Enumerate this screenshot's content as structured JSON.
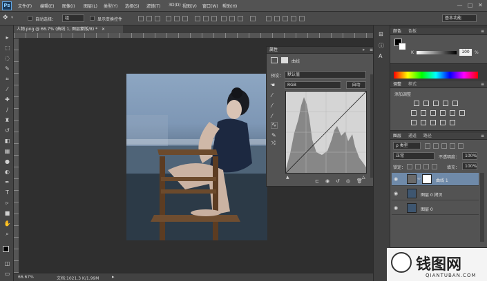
{
  "app": {
    "logo": "Ps",
    "menus": [
      "文件(F)",
      "编辑(E)",
      "图像(I)",
      "图层(L)",
      "类型(Y)",
      "选择(S)",
      "滤镜(T)",
      "3D(D)",
      "视图(V)",
      "窗口(W)",
      "帮助(H)"
    ],
    "window_controls": [
      "—",
      "□",
      "✕"
    ]
  },
  "options_bar": {
    "auto_select_label": "自动选择：",
    "auto_select_value": "组",
    "transform_label": "显示变换控件",
    "workspace": "基本功能"
  },
  "document": {
    "tab_title": "人物.png @ 66.7% (曲线 1, 图层蒙版/8) *",
    "tab_close": "✕",
    "zoom": "66.67%",
    "doc_info": "文档:1021.3 K/1.99M"
  },
  "properties": {
    "title": "属性",
    "adjustment_name": "曲线",
    "preset_label": "预设：",
    "preset_value": "默认值",
    "channel_value": "RGB",
    "auto_button": "自动"
  },
  "color_panel": {
    "tabs": [
      "颜色",
      "色板"
    ],
    "k_label": "K",
    "k_value": "100",
    "k_unit": "%"
  },
  "adjustments_panel": {
    "tabs": [
      "调整",
      "样式"
    ],
    "subtitle": "添加调整"
  },
  "layers_panel": {
    "tabs": [
      "图层",
      "通道",
      "路径"
    ],
    "filter_label": "ρ 类型",
    "blend_mode": "正常",
    "opacity_label": "不透明度：",
    "opacity_value": "100%",
    "lock_label": "锁定：",
    "fill_label": "填充：",
    "fill_value": "100%",
    "layers": [
      {
        "name": "曲线 1",
        "active": true
      },
      {
        "name": "图层 0 拷贝",
        "active": false
      },
      {
        "name": "图层 0",
        "active": false
      }
    ]
  },
  "watermark": {
    "brand": "钱图网",
    "url": "QIANTUBAN.COM"
  },
  "colors": {
    "accent": "#5fa7e8",
    "active_layer": "#6f8aa9"
  }
}
